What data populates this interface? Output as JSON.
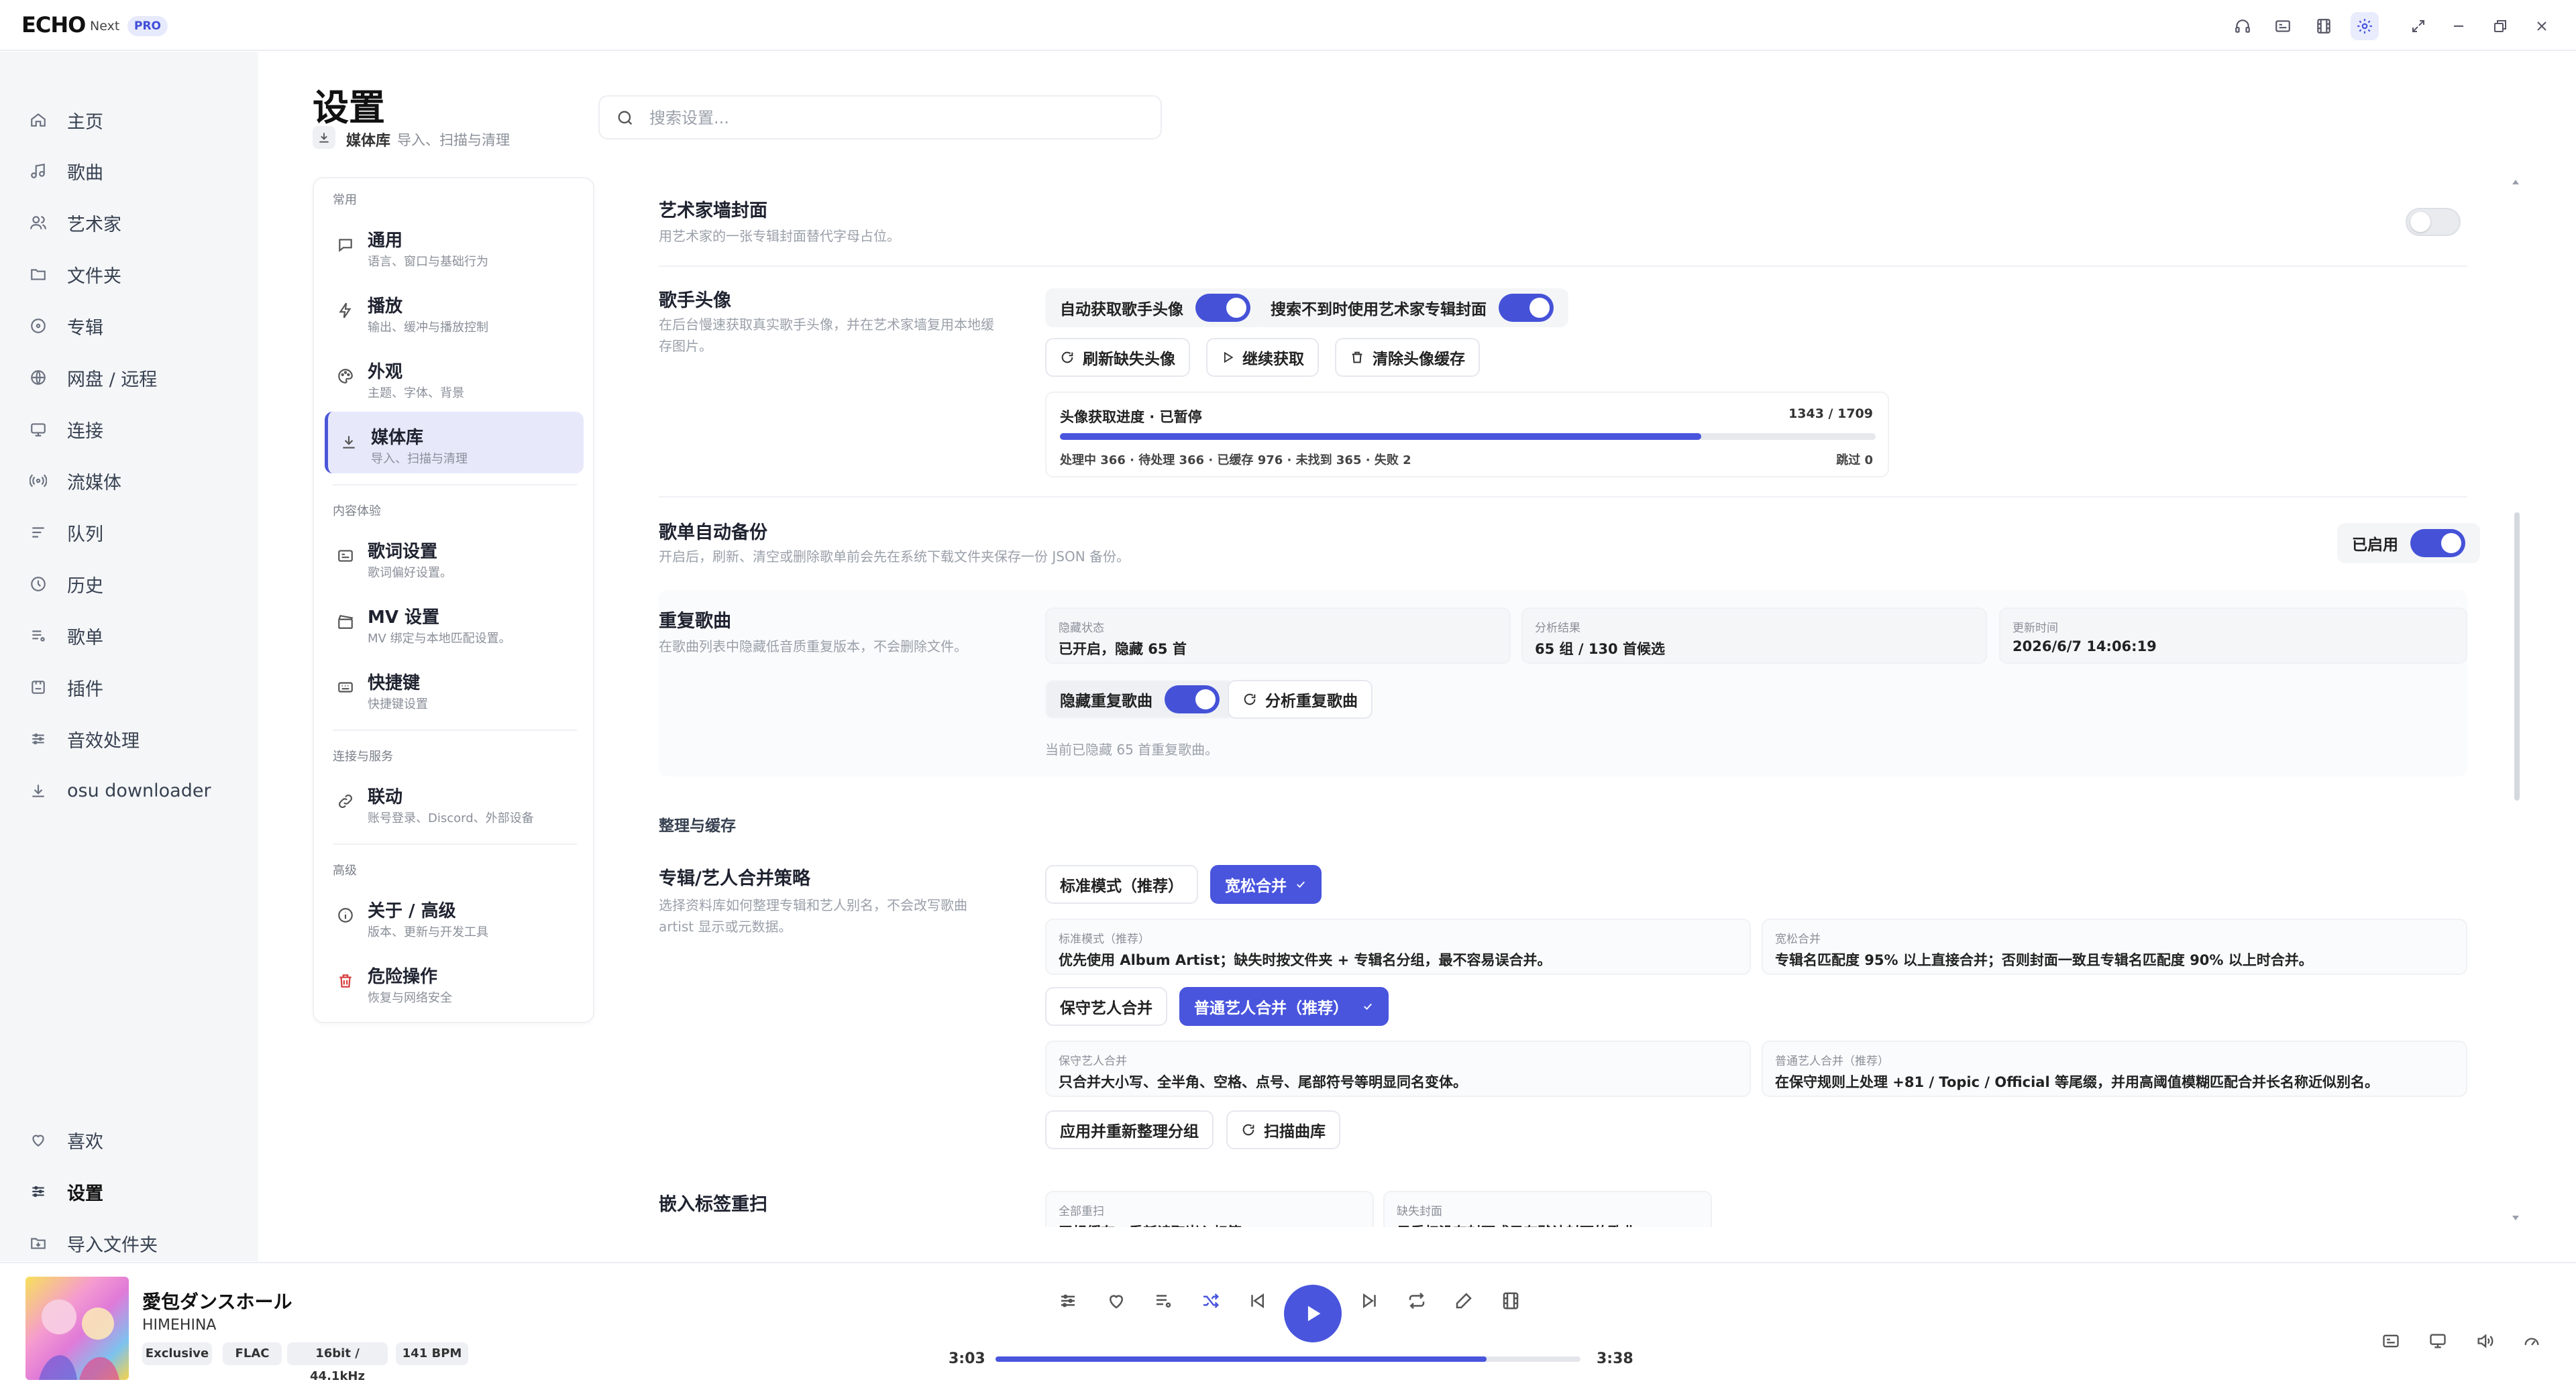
{
  "app": {
    "logo": "ECHO",
    "logo_sub": "Next",
    "badge": "PRO"
  },
  "nav": {
    "items": [
      "主页",
      "歌曲",
      "艺术家",
      "文件夹",
      "专辑",
      "网盘 / 远程",
      "连接",
      "流媒体",
      "队列",
      "历史",
      "歌单",
      "插件",
      "音效处理",
      "osu downloader"
    ],
    "bottom": [
      "喜欢",
      "设置",
      "导入文件夹"
    ]
  },
  "header": {
    "title": "设置",
    "sub_title": "媒体库",
    "sub_desc": "导入、扫描与清理",
    "search_placeholder": "搜索设置..."
  },
  "menu": {
    "sec_common": "常用",
    "general_t": "通用",
    "general_d": "语言、窗口与基础行为",
    "play_t": "播放",
    "play_d": "输出、缓冲与播放控制",
    "look_t": "外观",
    "look_d": "主题、字体、背景",
    "lib_t": "媒体库",
    "lib_d": "导入、扫描与清理",
    "sec_content": "内容体验",
    "lyric_t": "歌词设置",
    "lyric_d": "歌词偏好设置。",
    "mv_t": "MV 设置",
    "mv_d": "MV 绑定与本地匹配设置。",
    "keys_t": "快捷键",
    "keys_d": "快捷键设置",
    "sec_conn": "连接与服务",
    "link_t": "联动",
    "link_d": "账号登录、Discord、外部设备",
    "sec_adv": "高级",
    "about_t": "关于 / 高级",
    "about_d": "版本、更新与开发工具",
    "danger_t": "危险操作",
    "danger_d": "恢复与网络安全"
  },
  "content": {
    "wall_title": "艺术家墙封面",
    "wall_desc": "用艺术家的一张专辑封面替代字母占位。",
    "avatar_title": "歌手头像",
    "avatar_desc1": "在后台慢速获取真实歌手头像，并在艺术家墙复用本地缓",
    "avatar_desc2": "存图片。",
    "auto_avatar": "自动获取歌手头像",
    "fallback_album": "搜索不到时使用艺术家专辑封面",
    "refresh_missing": "刷新缺失头像",
    "continue_fetch": "继续获取",
    "clear_cache": "清除头像缓存",
    "progress_label": "头像获取进度 · 已暂停",
    "progress_count": "1343 / 1709",
    "progress_detail": "处理中 366 · 待处理 366 · 已缓存 976 · 未找到 365 · 失败 2",
    "skip": "跳过 0",
    "backup_title": "歌单自动备份",
    "backup_desc": "开启后，刷新、清空或删除歌单前会先在系统下载文件夹保存一份 JSON 备份。",
    "enabled": "已启用",
    "dup_title": "重复歌曲",
    "dup_desc": "在歌曲列表中隐藏低音质重复版本，不会删除文件。",
    "hide_state_k": "隐藏状态",
    "hide_state_v": "已开启，隐藏 65 首",
    "analyze_k": "分析结果",
    "analyze_v": "65 组 / 130 首候选",
    "update_k": "更新时间",
    "update_v": "2026/6/7 14:06:19",
    "hide_dup": "隐藏重复歌曲",
    "analyze_dup": "分析重复歌曲",
    "dup_note": "当前已隐藏 65 首重复歌曲。",
    "org_title": "整理与缓存",
    "merge_title": "专辑/艺人合并策略",
    "merge_desc1": "选择资料库如何整理专辑和艺人别名，不会改写歌曲",
    "merge_desc2": "artist 显示或元数据。",
    "std_mode": "标准模式（推荐）",
    "loose_merge": "宽松合并",
    "std_k": "标准模式（推荐）",
    "std_v": "优先使用 Album Artist；缺失时按文件夹 + 专辑名分组，最不容易误合并。",
    "loose_k": "宽松合并",
    "loose_v": "专辑名匹配度 95% 以上直接合并；否则封面一致且专辑名匹配度 90% 以上时合并。",
    "conservative": "保守艺人合并",
    "normal_artist": "普通艺人合并（推荐）",
    "cons_k": "保守艺人合并",
    "cons_v": "只合并大小写、全半角、空格、点号、尾部符号等明显同名变体。",
    "norm_k": "普通艺人合并（推荐）",
    "norm_v": "在保守规则上处理 +81 / Topic / Official 等尾缀，并用高阈值模糊匹配合并长名称近似别名。",
    "apply_regroup": "应用并重新整理分组",
    "scan_lib": "扫描曲库",
    "embed_title": "嵌入标签重扫",
    "full_rescan_k": "全部重扫",
    "full_rescan_v": "王规缓存，重新读取嵌入标签",
    "missing_cover_k": "缺失封面",
    "missing_cover_v": "只重扫没有封面或只有默认封面的歌曲"
  },
  "player": {
    "title": "愛包ダンスホール",
    "artist": "HIMEHINA",
    "tags": [
      "Exclusive",
      "FLAC",
      "16bit / 44.1kHz",
      "141 BPM"
    ],
    "time_current": "3:03",
    "time_total": "3:38",
    "progress": 0.84
  },
  "colors": {
    "accent": "#4955dd",
    "nav_bg": "#f5f6f8"
  }
}
